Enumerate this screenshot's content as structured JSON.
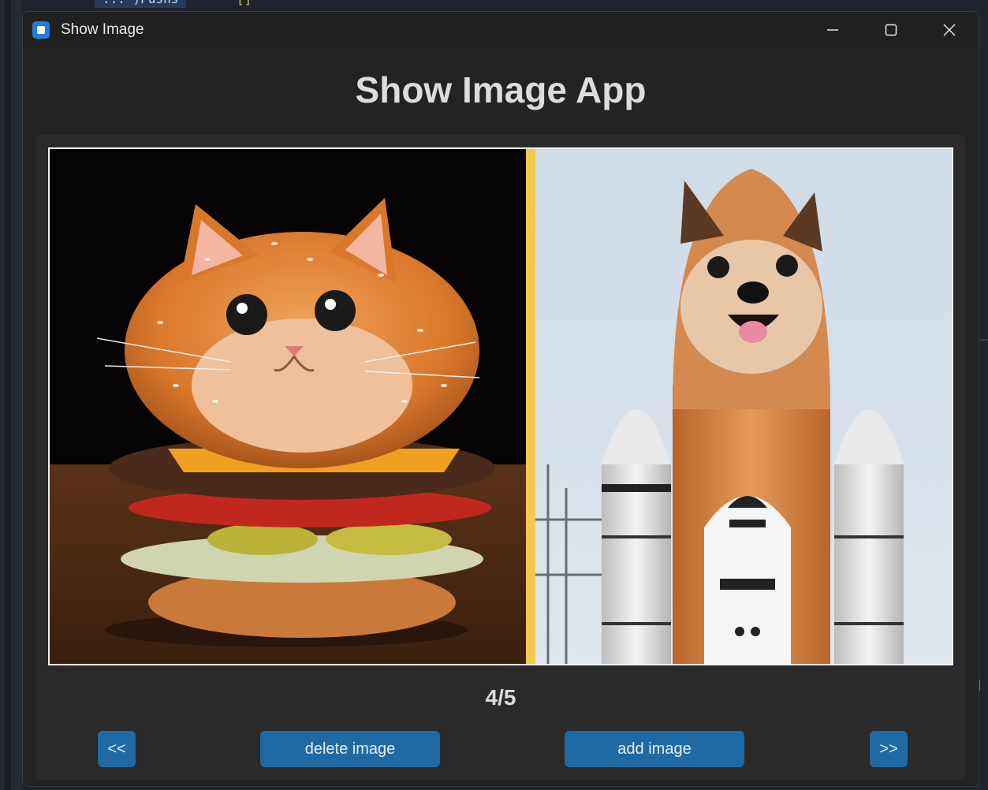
{
  "background": {
    "snippet": "...  )Pushs",
    "bracket": "[]"
  },
  "window": {
    "title": "Show Image",
    "icon": "app-icon",
    "controls": [
      "minimize-icon",
      "maximize-icon",
      "close-icon"
    ]
  },
  "app": {
    "heading": "Show Image App",
    "counter": "4/5",
    "buttons": {
      "prev": "<<",
      "delete": "delete image",
      "add": "add image",
      "next": ">>"
    }
  },
  "image": {
    "left_panel": "cat-burger image",
    "right_panel": "dog-rocket image",
    "divider_color": "#f2c94c"
  },
  "colors": {
    "button": "#1f6aa5",
    "window_bg": "#232323",
    "panel_bg": "#2a2a2a"
  }
}
